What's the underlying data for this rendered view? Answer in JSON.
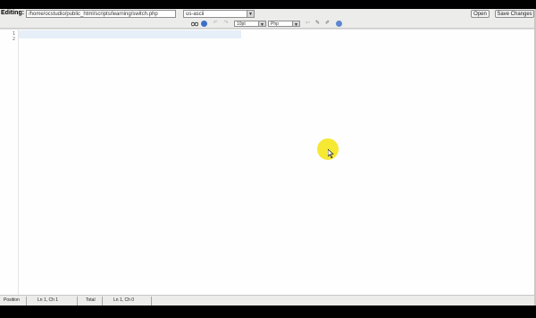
{
  "topbar": {
    "editing_label": "Editing:",
    "file_path": "/home/ocstudio/public_html/scripts/learning/switch.php",
    "encoding": "us-ascii",
    "open_label": "Open",
    "save_label": "Save Changes"
  },
  "toolbar": {
    "font_size": "10pt",
    "language": "Php"
  },
  "editor": {
    "line_numbers": [
      "1",
      "2"
    ]
  },
  "statusbar": {
    "position_label": "Position",
    "position_value": "Ln 1, Ch 1",
    "total_label": "Total",
    "total_value": "Ln 1, Ch 0"
  },
  "colors": {
    "background": "#ececea",
    "editor_background": "#fefefe",
    "active_line": "#e6eff8",
    "cursor_highlight": "#f5e82b"
  }
}
